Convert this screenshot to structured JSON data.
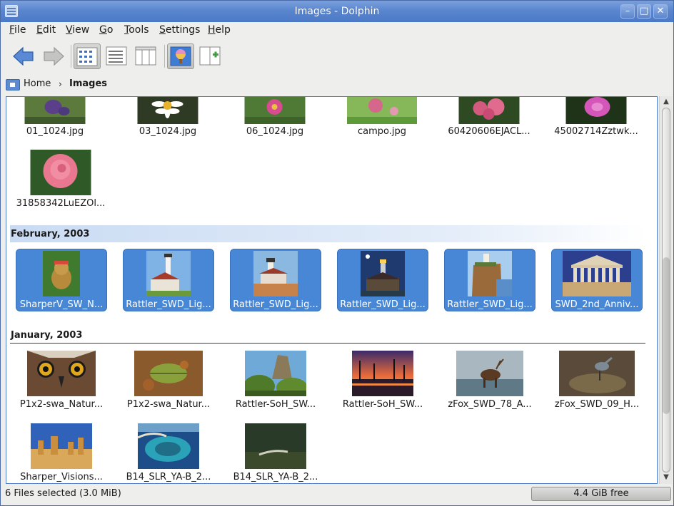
{
  "window": {
    "title": "Images - Dolphin",
    "minimize_glyph": "–",
    "maximize_glyph": "□",
    "close_glyph": "✕"
  },
  "menu": [
    {
      "label": "File",
      "u": "F",
      "rest": "ile"
    },
    {
      "label": "Edit",
      "u": "E",
      "rest": "dit"
    },
    {
      "label": "View",
      "u": "V",
      "rest": "iew"
    },
    {
      "label": "Go",
      "u": "G",
      "rest": "o"
    },
    {
      "label": "Tools",
      "u": "T",
      "rest": "ools"
    },
    {
      "label": "Settings",
      "u": "S",
      "rest": "ettings"
    },
    {
      "label": "Help",
      "u": "H",
      "rest": "elp"
    }
  ],
  "toolbar": {
    "icons": [
      "back-arrow-icon",
      "forward-arrow-icon",
      "icons-view-icon",
      "details-view-icon",
      "columns-view-icon",
      "preview-icon",
      "split-view-icon"
    ],
    "active": [
      "icons-view",
      "preview"
    ]
  },
  "breadcrumb": {
    "home": "Home",
    "separator": "›",
    "current": "Images"
  },
  "groups": [
    {
      "header": "",
      "items": [
        {
          "name": "01_1024.jpg"
        },
        {
          "name": "03_1024.jpg"
        },
        {
          "name": "06_1024.jpg"
        },
        {
          "name": "campo.jpg"
        },
        {
          "name": "60420606EJACL..."
        },
        {
          "name": "45002714Zztwk..."
        },
        {
          "name": "31858342LuEZOl..."
        }
      ]
    },
    {
      "header": "February, 2003",
      "items": [
        {
          "name": "SharperV_SW_N...",
          "selected": true
        },
        {
          "name": "Rattler_SWD_Lig...",
          "selected": true
        },
        {
          "name": "Rattler_SWD_Lig...",
          "selected": true
        },
        {
          "name": "Rattler_SWD_Lig...",
          "selected": true
        },
        {
          "name": "Rattler_SWD_Lig...",
          "selected": true
        },
        {
          "name": "SWD_2nd_Anniv...",
          "selected": true
        }
      ]
    },
    {
      "header": "January, 2003",
      "items": [
        {
          "name": "P1x2-swa_Natur..."
        },
        {
          "name": "P1x2-swa_Natur..."
        },
        {
          "name": "Rattler-SoH_SW..."
        },
        {
          "name": "Rattler-SoH_SW..."
        },
        {
          "name": "zFox_SWD_78_A..."
        },
        {
          "name": "zFox_SWD_09_H..."
        },
        {
          "name": "Sharper_Visions..."
        },
        {
          "name": "B14_SLR_YA-B_2..."
        },
        {
          "name": "B14_SLR_YA-B_2..."
        }
      ]
    }
  ],
  "status": {
    "text": "6 Files selected (3.0 MiB)",
    "free_space": "4.4 GiB free",
    "used_fraction": 0.97
  },
  "colors": {
    "selection": "#4787d6",
    "titlebar": "#5a86cf",
    "group_highlight": "#c9dbf3"
  }
}
